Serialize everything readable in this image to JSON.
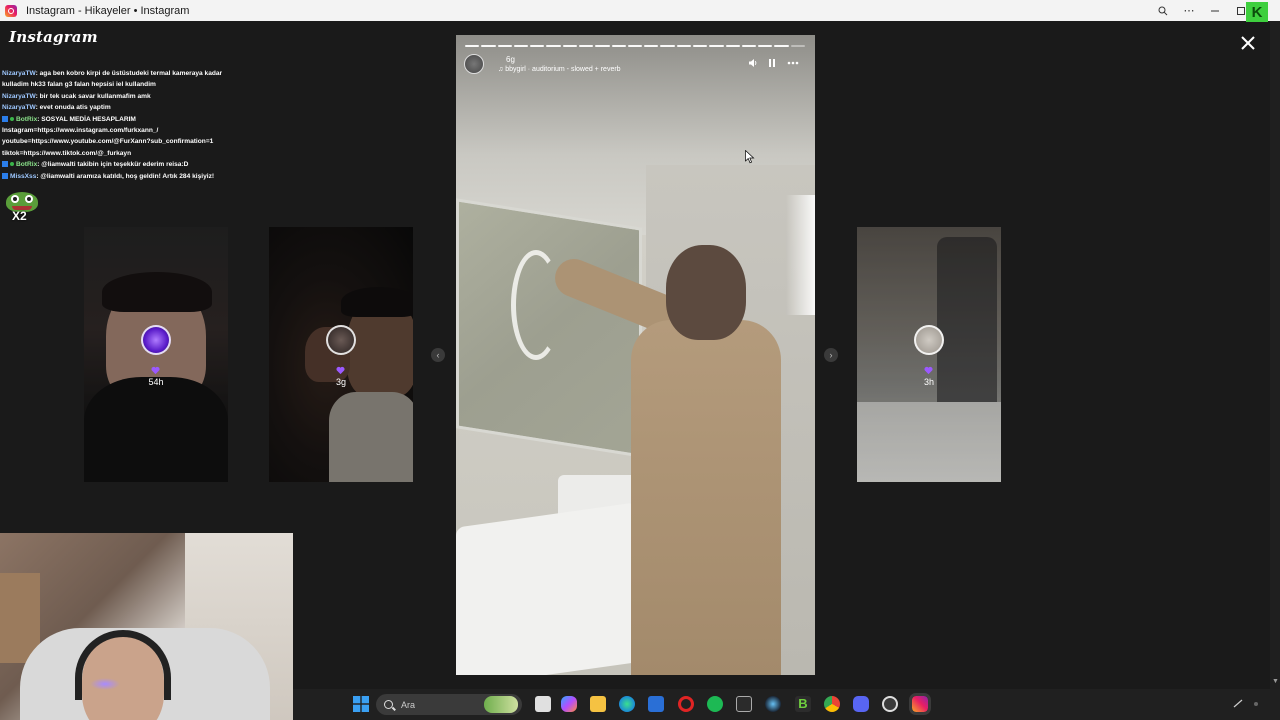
{
  "window": {
    "title": "Instagram - Hikayeler • Instagram",
    "logo_letter": "K"
  },
  "app": {
    "brand": "Instagram",
    "close_icon": "×"
  },
  "chat": [
    {
      "user": "NizaryaTW",
      "text": ": aga ben kobro kirpi de üstüstudeki termal kameraya kadar",
      "type": "user"
    },
    {
      "user": "",
      "text": "kulladim hk33 falan g3 falan hepsisi iel kullandim",
      "type": "cont"
    },
    {
      "user": "NizaryaTW",
      "text": ": bir tek ucak savar kullanmafim amk",
      "type": "user"
    },
    {
      "user": "NizaryaTW",
      "text": ": evet onuda atis yaptim",
      "type": "user"
    },
    {
      "user": "BotRix",
      "text": ": SOSYAL MEDİA HESAPLARIM",
      "type": "bot"
    },
    {
      "user": "",
      "text": "Instagram=https://www.instagram.com/furkxann_/",
      "type": "cont"
    },
    {
      "user": "",
      "text": "youtube=https://www.youtube.com/@FurXann?sub_confirmation=1",
      "type": "cont"
    },
    {
      "user": "",
      "text": "tiktok=https://www.tiktok.com/@_furkayn",
      "type": "cont"
    },
    {
      "user": "BotRix",
      "text": ": @liamwalti takibin için teşekkür ederim reisa:D",
      "type": "bot"
    },
    {
      "user": "MissXss",
      "text": ": @liamwalti aramıza katıldı, hoş geldin! Artık 284 kişiyiz!",
      "type": "user"
    }
  ],
  "emote": {
    "label": "X2"
  },
  "stories": {
    "left_cards": [
      {
        "time": "54h"
      },
      {
        "time": "3g"
      }
    ],
    "right_cards": [
      {
        "time": "3h"
      }
    ],
    "current": {
      "time": "6g",
      "music": "bbygirl · auditorium - slowed + reverb",
      "progress_segments": 21,
      "progress_done": 20
    }
  },
  "taskbar": {
    "search_placeholder": "Ara",
    "icons": [
      "windows-start-icon",
      "search-icon",
      "task-view-icon",
      "copilot-icon",
      "file-explorer-icon",
      "edge-icon",
      "store-icon",
      "opera-icon",
      "spotify-icon",
      "epic-games-icon",
      "steam-icon",
      "b-app-icon",
      "chrome-icon",
      "discord-icon",
      "obs-icon",
      "instagram-icon"
    ]
  }
}
